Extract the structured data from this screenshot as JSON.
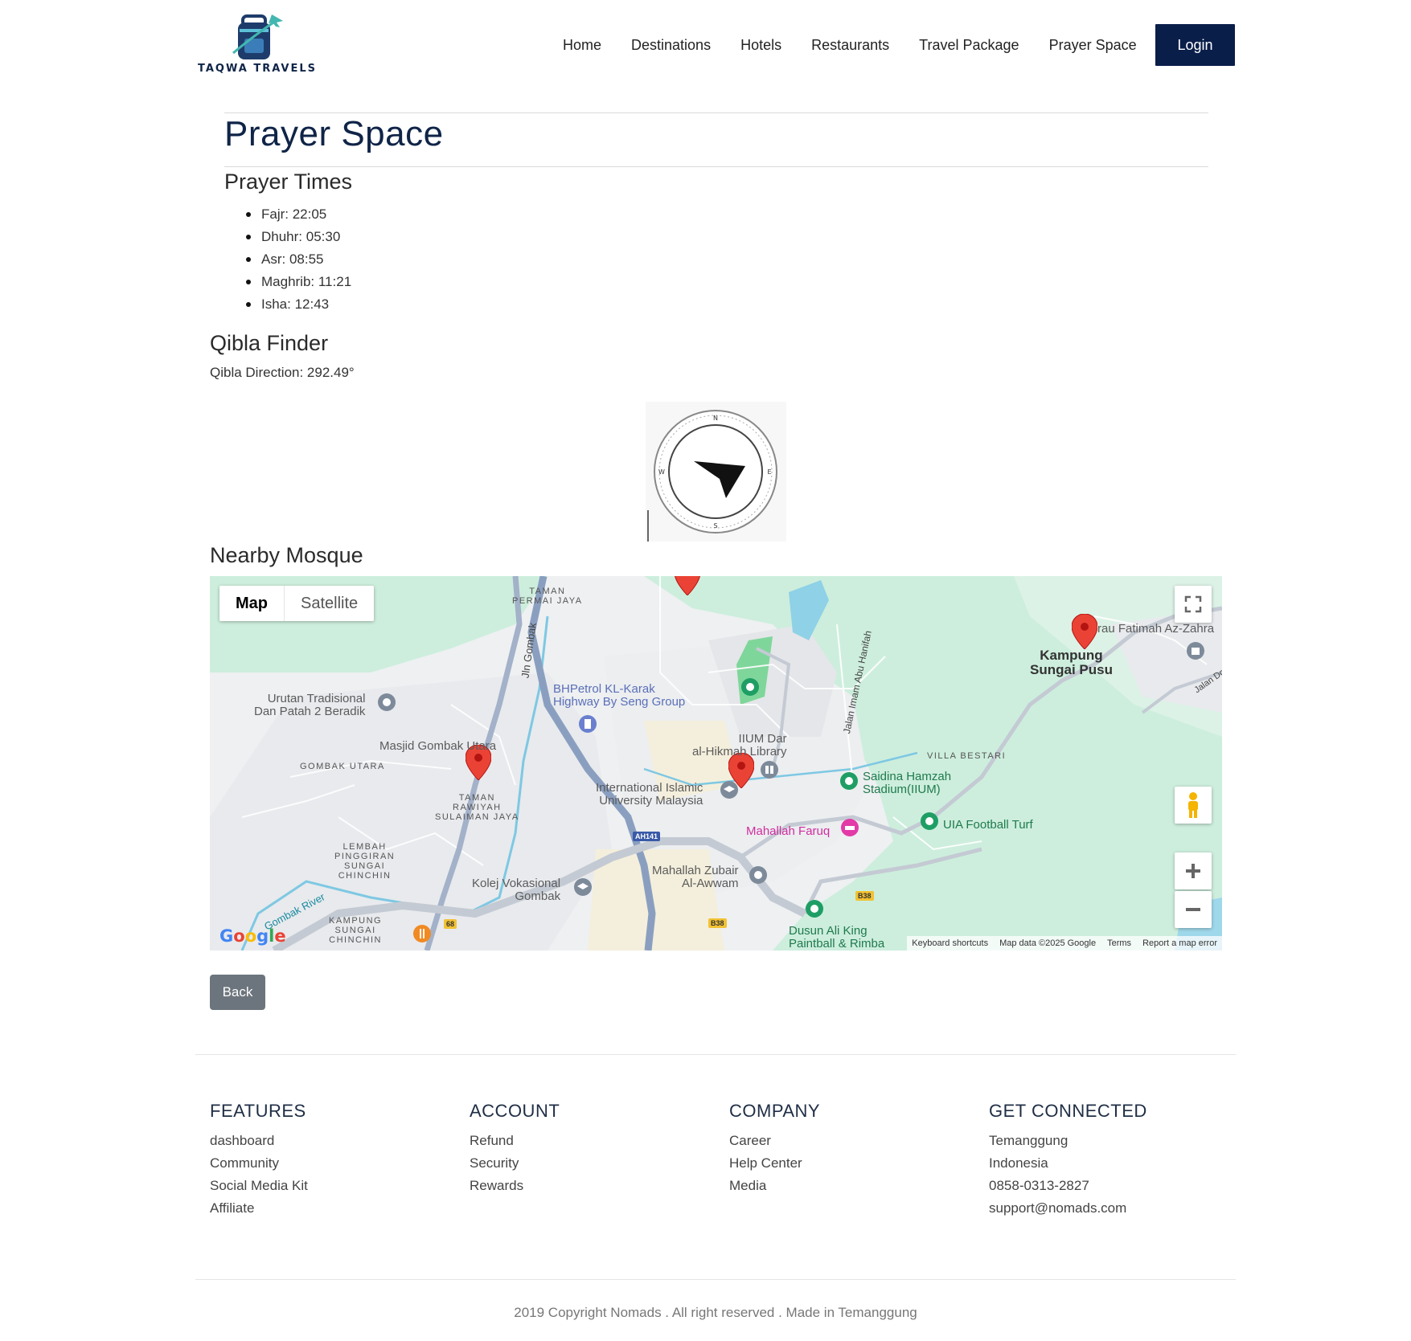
{
  "header": {
    "logo_text": "TAQWA TRAVELS",
    "nav": [
      "Home",
      "Destinations",
      "Hotels",
      "Restaurants",
      "Travel Package",
      "Prayer Space"
    ],
    "login": "Login"
  },
  "page": {
    "title": "Prayer Space",
    "prayer_times_heading": "Prayer Times",
    "prayer_times": [
      "Fajr: 22:05",
      "Dhuhr: 05:30",
      "Asr: 08:55",
      "Maghrib: 11:21",
      "Isha: 12:43"
    ],
    "qibla_heading": "Qibla Finder",
    "qibla_direction": "Qibla Direction: 292.49°",
    "mosque_heading": "Nearby Mosque",
    "back": "Back"
  },
  "map": {
    "types": [
      "Map",
      "Satellite"
    ],
    "footer": [
      "Keyboard shortcuts",
      "Map data ©2025 Google",
      "Terms",
      "Report a map error"
    ],
    "google": "Google",
    "labels": {
      "taman_permai": "TAMAN\nPERMAI JAYA",
      "urutan": "Urutan Tradisional\nDan Patah 2 Beradik",
      "bhpetrol": "BHPetrol KL-Karak\nHighway By Seng Group",
      "masjid": "Masjid Gombak Utara",
      "gombak_utara": "GOMBAK UTARA",
      "taman_rawiyah": "TAMAN\nRAWIYAH\nSULAIMAN JAYA",
      "iium_library": "IIUM Dar\nal-Hikmah Library",
      "iium": "International Islamic\nUniversity Malaysia",
      "lembah": "LEMBAH\nPINGGIRAN\nSUNGAI\nCHINCHIN",
      "kolej": "Kolej Vokasional\nGombak",
      "zubair": "Mahallah Zubair\nAl-Awwam",
      "faruq": "Mahallah Faruq",
      "saidina": "Saidina Hamzah\nStadium(IIUM)",
      "uia": "UIA Football Turf",
      "villa": "VILLA BESTARI",
      "kampung": "Kampung\nSungai Pusu",
      "fatimah": "rau Fatimah Az-Zahra",
      "dusun": "Dusun Ali King\nPaintball & Rimba",
      "kampung_chinchin": "KAMPUNG\nSUNGAI\nCHINCHIN",
      "gombak_river": "Gombak River",
      "jln_gombak": "Jln Gombak",
      "jalan_imam": "Jalan Imam Abu Hanifah",
      "jalan_dc": "Jalan Dc",
      "ah141": "AH141",
      "b38a": "B38",
      "b38b": "B38",
      "r68": "68"
    }
  },
  "footer": {
    "columns": [
      {
        "heading": "FEATURES",
        "items": [
          "dashboard",
          "Community",
          "Social Media Kit",
          "Affiliate"
        ]
      },
      {
        "heading": "ACCOUNT",
        "items": [
          "Refund",
          "Security",
          "Rewards"
        ]
      },
      {
        "heading": "COMPANY",
        "items": [
          "Career",
          "Help Center",
          "Media"
        ]
      },
      {
        "heading": "GET CONNECTED",
        "items": [
          "Temanggung",
          "Indonesia",
          "0858-0313-2827",
          "support@nomads.com"
        ]
      }
    ],
    "copyright": "2019 Copyright Nomads . All right reserved . Made in Temanggung"
  },
  "colors": {
    "brand_navy": "#0a1e4a",
    "back_button": "#6c757d",
    "map_green": "#cdeedd",
    "marker_red": "#ea4335"
  }
}
